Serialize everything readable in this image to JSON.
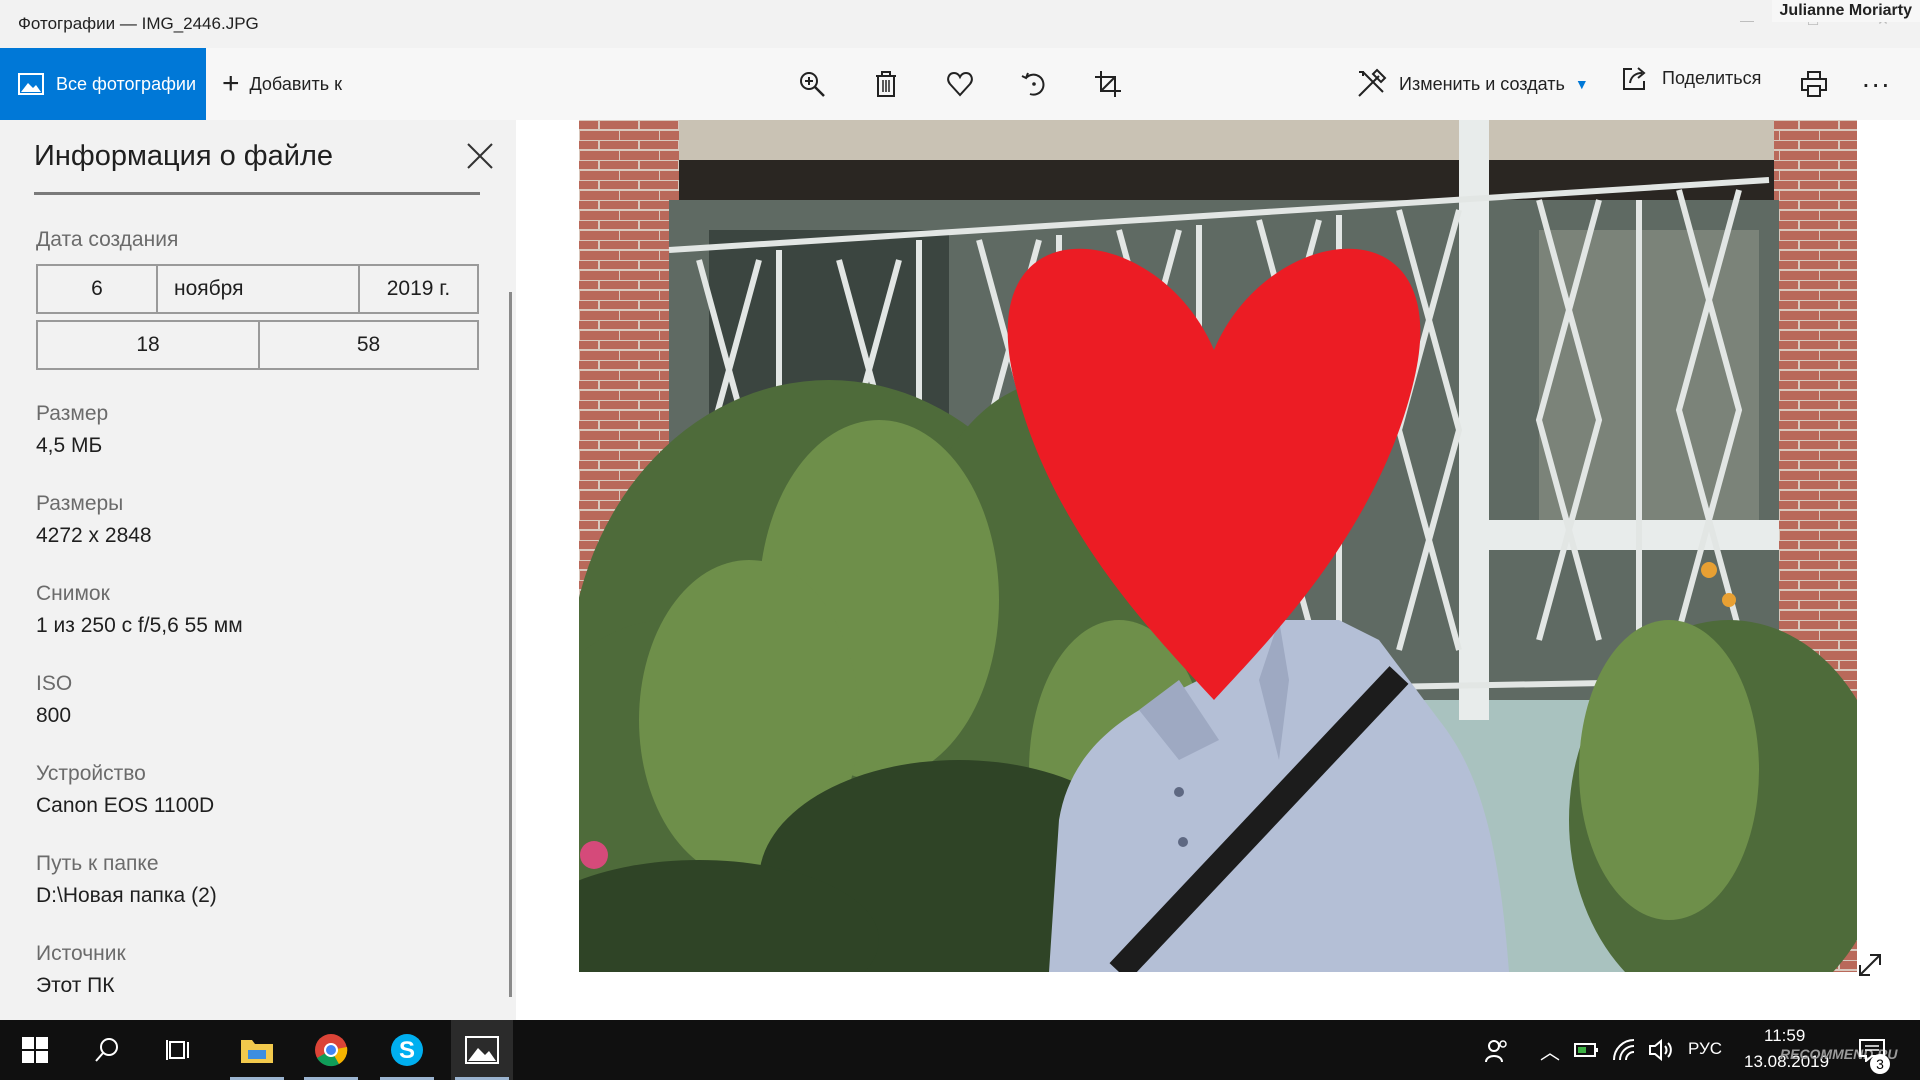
{
  "window": {
    "title": "Фотографии — IMG_2446.JPG",
    "user": "Julianne Moriarty"
  },
  "toolbar": {
    "all_photos_label": "Все фотографии",
    "add_to_label": "Добавить к",
    "edit_create_label": "Изменить и создать",
    "share_label": "Поделиться",
    "more_label": "...",
    "icons": [
      "zoom-in-icon",
      "trash-icon",
      "heart-icon",
      "rotate-icon",
      "crop-icon",
      "print-icon"
    ]
  },
  "info_panel": {
    "title": "Информация о файле",
    "date_created_label": "Дата создания",
    "date": {
      "day": "6",
      "month": "ноября",
      "year": "2019 г."
    },
    "time": {
      "hour": "18",
      "minute": "58"
    },
    "fields": [
      {
        "label": "Размер",
        "value": "4,5 МБ"
      },
      {
        "label": "Размеры",
        "value": "4272 x 2848"
      },
      {
        "label": "Снимок",
        "value": "1 из 250 с f/5,6 55 мм"
      },
      {
        "label": "ISO",
        "value": "800"
      },
      {
        "label": "Устройство",
        "value": "Canon EOS 1100D"
      },
      {
        "label": "Путь к папке",
        "value": "D:\\Новая папка (2)"
      },
      {
        "label": "Источник",
        "value": "Этот ПК"
      }
    ]
  },
  "taskbar": {
    "language": "РУС",
    "time": "11:59",
    "date": "13.08.2019",
    "notification_count": "3",
    "watermark": "RECOMMEND.RU"
  },
  "colors": {
    "accent": "#0078d7",
    "heart": "#ec1c24"
  }
}
